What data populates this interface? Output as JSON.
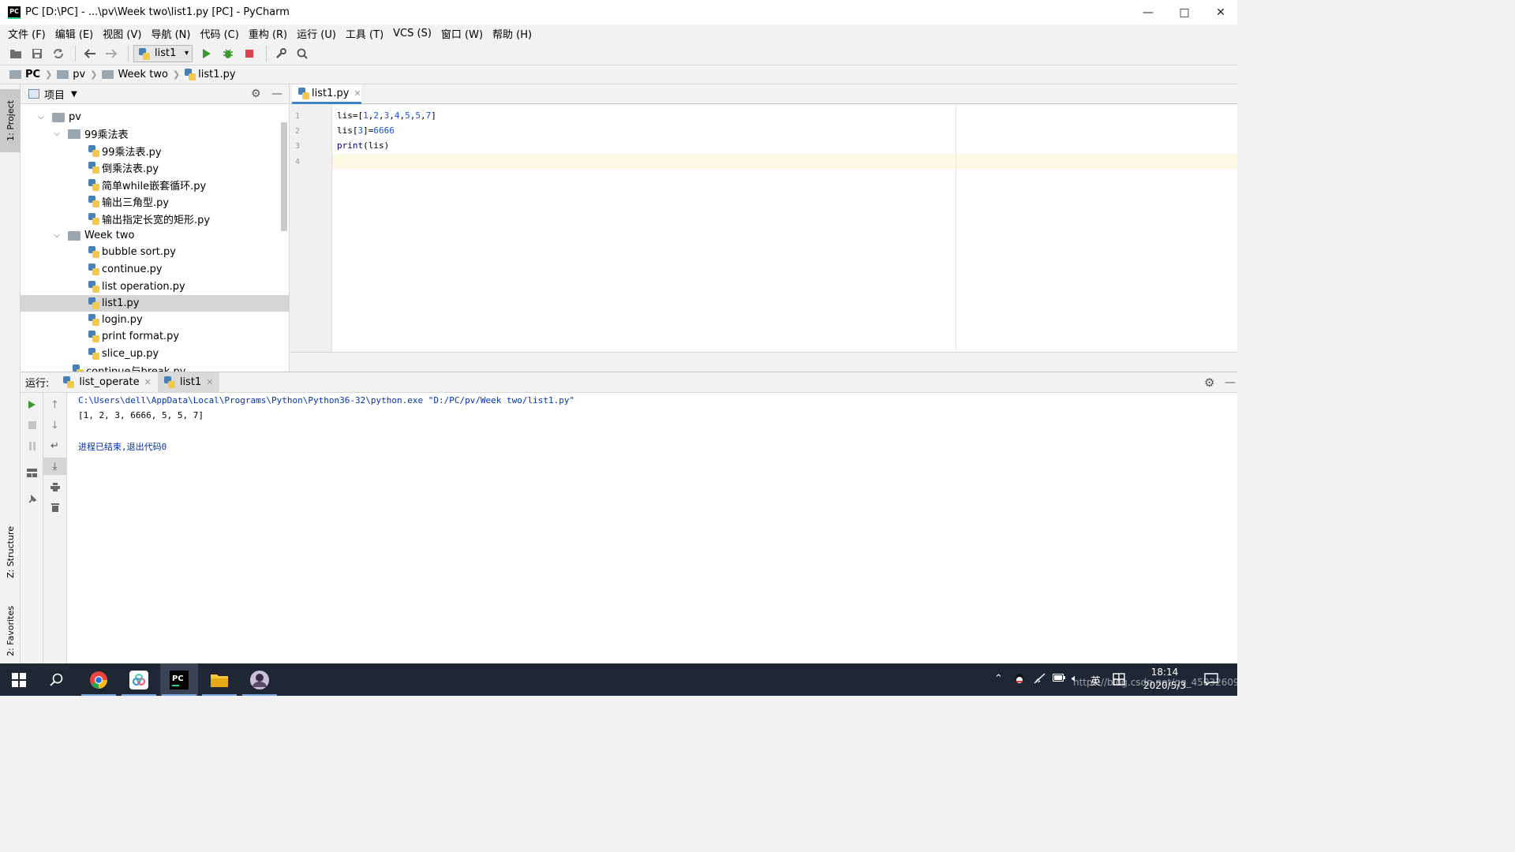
{
  "window": {
    "title": "PC [D:\\PC] - ...\\pv\\Week two\\list1.py [PC] - PyCharm",
    "app_icon_text": "PC"
  },
  "menu": [
    "文件 (F)",
    "编辑 (E)",
    "视图 (V)",
    "导航 (N)",
    "代码 (C)",
    "重构 (R)",
    "运行 (U)",
    "工具 (T)",
    "VCS (S)",
    "窗口 (W)",
    "帮助 (H)"
  ],
  "toolbar": {
    "run_config": "list1"
  },
  "breadcrumb": [
    "PC",
    "pv",
    "Week two",
    "list1.py"
  ],
  "left_strip": {
    "project": "1: Project",
    "structure": "Z: Structure",
    "favorites": "2: Favorites"
  },
  "project": {
    "header": "项目",
    "tree": [
      {
        "label": "pv",
        "type": "folder",
        "level": 1
      },
      {
        "label": "99乘法表",
        "type": "folder",
        "level": 2
      },
      {
        "label": "99乘法表.py",
        "type": "py",
        "level": 3
      },
      {
        "label": "倒乘法表.py",
        "type": "py",
        "level": 3
      },
      {
        "label": "简单while嵌套循环.py",
        "type": "py",
        "level": 3
      },
      {
        "label": "输出三角型.py",
        "type": "py",
        "level": 3
      },
      {
        "label": "输出指定长宽的矩形.py",
        "type": "py",
        "level": 3
      },
      {
        "label": "Week two",
        "type": "folder",
        "level": 2
      },
      {
        "label": "bubble sort.py",
        "type": "py",
        "level": 3
      },
      {
        "label": "continue.py",
        "type": "py",
        "level": 3
      },
      {
        "label": "list operation.py",
        "type": "py",
        "level": 3
      },
      {
        "label": "list1.py",
        "type": "py",
        "level": 3,
        "selected": true
      },
      {
        "label": "login.py",
        "type": "py",
        "level": 3
      },
      {
        "label": "print format.py",
        "type": "py",
        "level": 3
      },
      {
        "label": "slice_up.py",
        "type": "py",
        "level": 3
      },
      {
        "label": "continue与break.py",
        "type": "py",
        "level": 2
      }
    ]
  },
  "editor": {
    "tab": "list1.py",
    "line_numbers": [
      "1",
      "2",
      "3",
      "4"
    ],
    "code": {
      "l1_a": "lis=[",
      "l1_n1": "1",
      "l1_n2": "2",
      "l1_n3": "3",
      "l1_n4": "4",
      "l1_n5": "5",
      "l1_n6": "5",
      "l1_n7": "7",
      "l1_end": "]",
      "l2_a": "lis[",
      "l2_idx": "3",
      "l2_b": "]=",
      "l2_val": "6666",
      "l3_fn": "print",
      "l3_rest": "(lis)"
    }
  },
  "run": {
    "title": "运行:",
    "tabs": [
      "list_operate",
      "list1"
    ],
    "console": [
      "C:\\Users\\dell\\AppData\\Local\\Programs\\Python\\Python36-32\\python.exe \"D:/PC/pv/Week two/list1.py\"",
      "[1, 2, 3, 6666, 5, 5, 7]",
      "进程已结束,退出代码0"
    ]
  },
  "taskbar": {
    "time": "18:14",
    "date": "2020/5/3",
    "ime": "英",
    "watermark": "https://blog.csdn.net/qq_45032609"
  },
  "colors": {
    "accent": "#4083c9",
    "console_path": "#0033b3",
    "run_green": "#3a9a2f",
    "stop_red": "#d9434c",
    "number_blue": "#1750eb"
  }
}
